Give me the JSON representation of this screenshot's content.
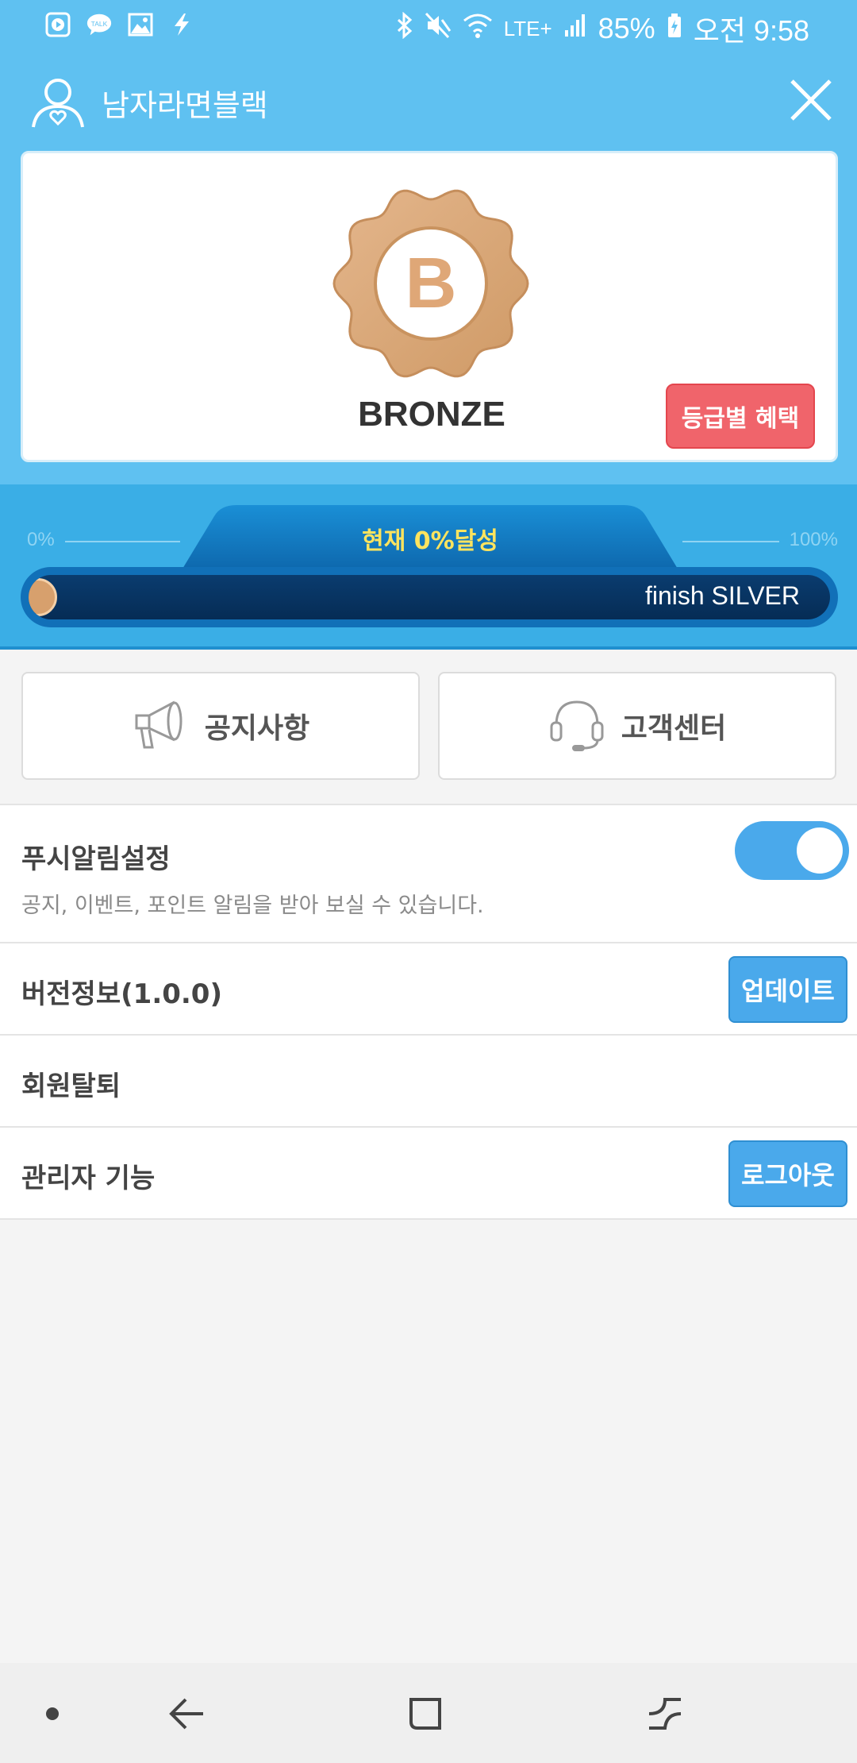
{
  "status_bar": {
    "battery": "85%",
    "time": "오전 9:58",
    "network": "LTE+",
    "left_icons": [
      "play-icon",
      "talk-icon",
      "image-icon",
      "flash-icon"
    ],
    "right_icons": [
      "bluetooth-icon",
      "mute-icon",
      "wifi-icon",
      "signal-icon",
      "battery-icon"
    ]
  },
  "header": {
    "username": "남자라면블랙",
    "grade": "BRONZE",
    "badge_letter": "B",
    "benefit_button": "등급별 혜택"
  },
  "progress": {
    "left_label": "0%",
    "right_label": "100%",
    "current_text": "현재 0%달성",
    "percent": 0,
    "target_text": "finish SILVER"
  },
  "quick_links": {
    "notice": "공지사항",
    "support": "고객센터"
  },
  "settings": {
    "push_title": "푸시알림설정",
    "push_desc": "공지, 이벤트, 포인트 알림을 받아 보실 수 있습니다.",
    "push_enabled": true,
    "version_title": "버전정보(1.0.0)",
    "update_button": "업데이트",
    "withdraw_title": "회원탈퇴",
    "admin_title": "관리자 기능",
    "logout_button": "로그아웃"
  },
  "colors": {
    "header_bg": "#5fc1f1",
    "progress_bg": "#3aaee6",
    "accent_blue": "#4aa9eb",
    "benefit_red": "#f0646b",
    "bronze": "#d9a16f"
  }
}
